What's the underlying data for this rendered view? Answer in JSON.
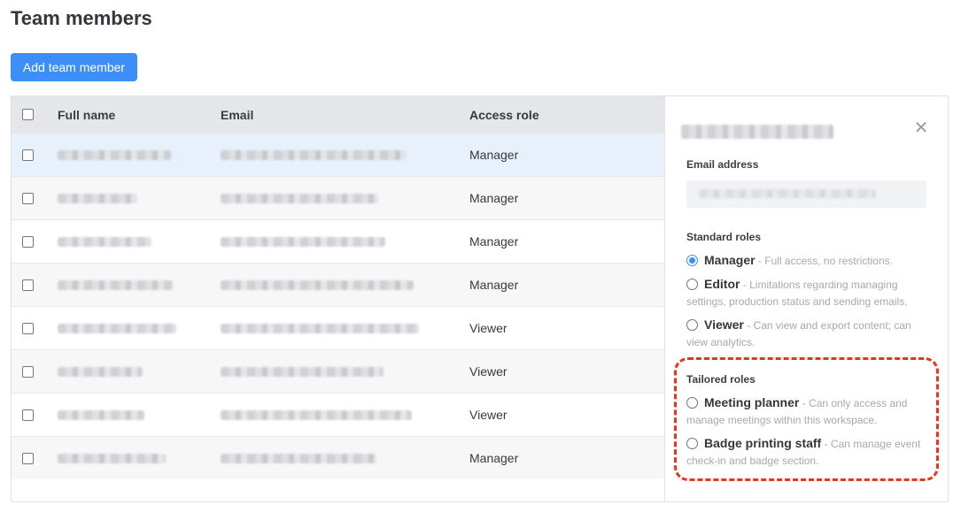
{
  "page": {
    "title": "Team members",
    "add_button": "Add team member"
  },
  "table": {
    "headers": {
      "name": "Full name",
      "email": "Email",
      "role": "Access role"
    },
    "rows": [
      {
        "role": "Manager"
      },
      {
        "role": "Manager"
      },
      {
        "role": "Manager"
      },
      {
        "role": "Manager"
      },
      {
        "role": "Viewer"
      },
      {
        "role": "Viewer"
      },
      {
        "role": "Viewer"
      },
      {
        "role": "Manager"
      }
    ]
  },
  "sidebar": {
    "close_icon": "close-icon",
    "email_label": "Email address",
    "standard_label": "Standard roles",
    "tailored_label": "Tailored roles",
    "roles": [
      {
        "name": "Manager",
        "desc": " - Full access, no restrictions.",
        "checked": true
      },
      {
        "name": "Editor",
        "desc": " - Limitations regarding managing settings, production status and sending emails.",
        "checked": false
      },
      {
        "name": "Viewer",
        "desc": " - Can view and export content; can view analytics.",
        "checked": false
      },
      {
        "name": "Meeting planner",
        "desc": " - Can only access and manage meetings within this workspace.",
        "checked": false
      },
      {
        "name": "Badge printing staff",
        "desc": " - Can manage event check-in and badge section.",
        "checked": false
      }
    ]
  },
  "colors": {
    "accent": "#3c8ff8",
    "highlight": "#e4361b",
    "selected_row": "#e7f0fb"
  }
}
